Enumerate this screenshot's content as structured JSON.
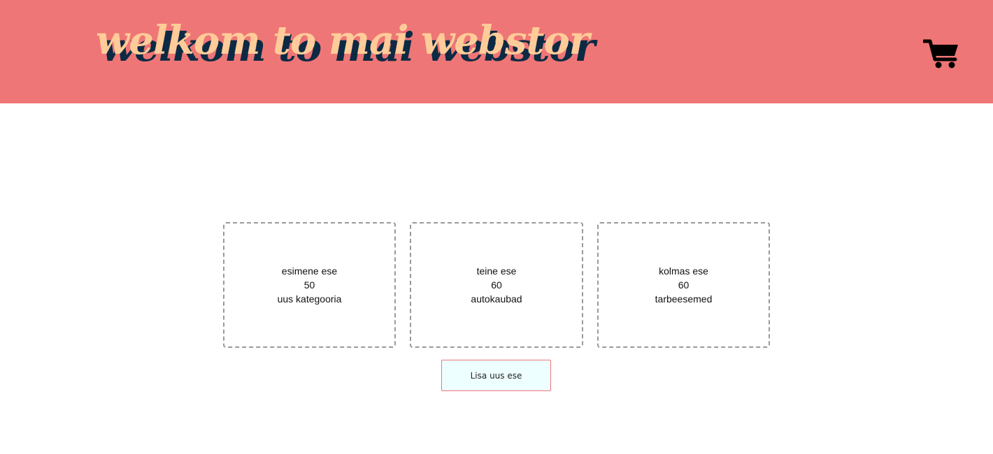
{
  "header": {
    "title": "welkom to mai webstor",
    "background_color": "#ef7676",
    "title_color": "#ffcc99",
    "title_shadow_color": "#0c2a44",
    "cart_icon": "shopping-cart-icon"
  },
  "products": [
    {
      "name": "esimene ese",
      "price": "50",
      "category": "uus kategooria"
    },
    {
      "name": "teine ese",
      "price": "60",
      "category": "autokaubad"
    },
    {
      "name": "kolmas ese",
      "price": "60",
      "category": "tarbeesemed"
    }
  ],
  "actions": {
    "add_item_label": "Lisa uus ese",
    "add_item_bg": "#eeffff",
    "add_item_border": "#ef7676"
  }
}
